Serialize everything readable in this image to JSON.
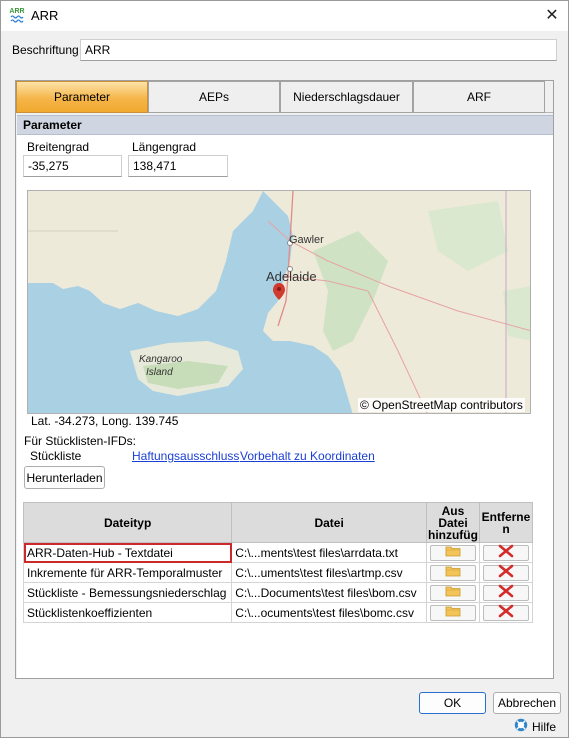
{
  "window": {
    "title": "ARR",
    "logo_text": "ARR",
    "close_glyph": "✕"
  },
  "form": {
    "caption_label": "Beschriftung",
    "caption_value": "ARR"
  },
  "tabs": [
    {
      "label": "Parameter",
      "active": true
    },
    {
      "label": "AEPs",
      "active": false
    },
    {
      "label": "Niederschlagsdauer",
      "active": false
    },
    {
      "label": "ARF",
      "active": false
    }
  ],
  "parameters": {
    "header": "Parameter",
    "latitude_label": "Breitengrad",
    "latitude_value": "-35,275",
    "longitude_label": "Längengrad",
    "longitude_value": "138,471"
  },
  "map": {
    "labels": {
      "gawler": "Gawler",
      "adelaide": "Adelaide",
      "kangaroo_island": "Kangaroo\nIsland",
      "kangaroo_1": "Kangaroo",
      "kangaroo_2": "Island"
    },
    "coords_text": "Lat. -34.273, Long. 139.745",
    "credit": "© OpenStreetMap contributors",
    "marker_icon": "map-pin-icon",
    "colors": {
      "sea": "#a9d0e3",
      "land": "#eeead9",
      "marker": "#d13a2e"
    }
  },
  "ifd": {
    "section_label": "Für Stücklisten-IFDs:",
    "stueckliste_label": "Stückliste",
    "disclaimer_link": "Haftungsausschluss",
    "coords_link": "Vorbehalt zu Koordinaten",
    "download_button": "Herunterladen"
  },
  "files_table": {
    "columns": [
      "Dateityp",
      "Datei",
      "Aus Datei hinzufüg",
      "Entferne n"
    ],
    "rows": [
      {
        "type": "ARR-Daten-Hub - Textdatei",
        "file": "C:\\...ments\\test files\\arrdata.txt"
      },
      {
        "type": "Inkremente für ARR-Temporalmuster",
        "file": "C:\\...uments\\test files\\artmp.csv"
      },
      {
        "type": "Stückliste - Bemessungsniederschlag",
        "file": "C:\\...Documents\\test files\\bom.csv"
      },
      {
        "type": "Stücklistenkoeffizienten",
        "file": "C:\\...ocuments\\test files\\bomc.csv"
      }
    ],
    "add_icon": "folder-icon",
    "remove_icon": "red-x-icon"
  },
  "footer": {
    "ok_button": "OK",
    "cancel_button": "Abbrechen",
    "help_label": "Hilfe",
    "help_icon": "help-icon"
  }
}
